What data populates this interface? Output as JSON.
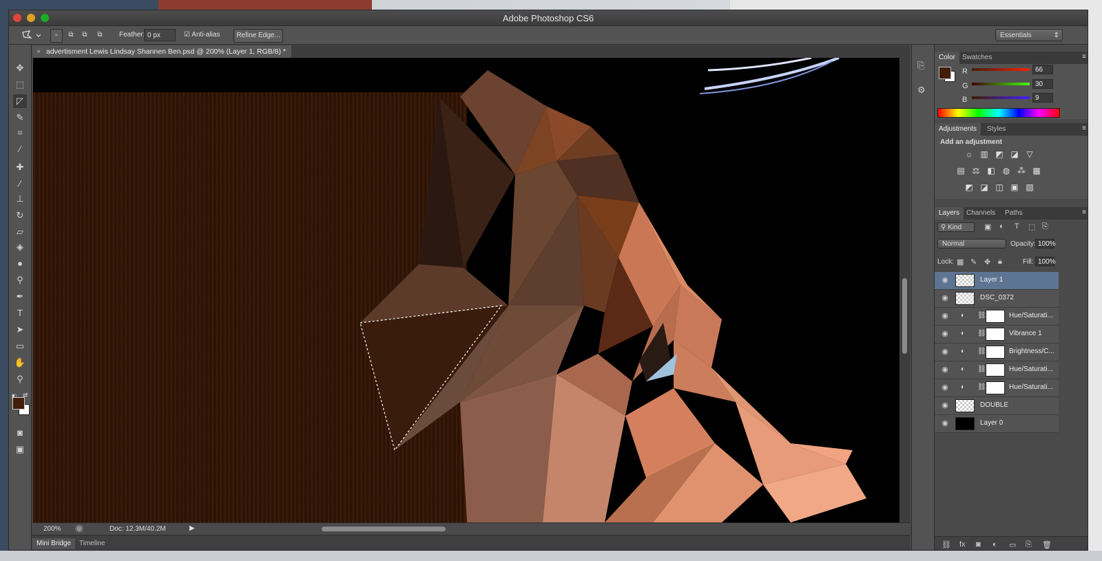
{
  "window": {
    "title": "Adobe Photoshop CS6"
  },
  "options_bar": {
    "feather_label": "Feather:",
    "feather_value": "0 px",
    "antialias_label": "Anti-alias",
    "refine_edge_label": "Refine Edge...",
    "workspace": "Essentials"
  },
  "document": {
    "tab_title": "advertisment Lewis Lindsay Shannen Ben.psd @ 200% (Layer 1, RGB/8) *",
    "close_glyph": "×"
  },
  "status": {
    "zoom": "200%",
    "doc_info": "Doc: 12.3M/40.2M"
  },
  "bottom_tabs": [
    "Mini Bridge",
    "Timeline"
  ],
  "color_panel": {
    "tabs": [
      "Color",
      "Swatches"
    ],
    "r_label": "R",
    "g_label": "G",
    "b_label": "B",
    "r": "66",
    "g": "30",
    "b": "9",
    "foreground": "#421e09"
  },
  "adjustments_panel": {
    "tabs": [
      "Adjustments",
      "Styles"
    ],
    "heading": "Add an adjustment"
  },
  "layers_panel": {
    "tabs": [
      "Layers",
      "Channels",
      "Paths"
    ],
    "filter_kind": "Kind",
    "blend_mode": "Normal",
    "opacity_label": "Opacity:",
    "opacity_value": "100%",
    "lock_label": "Lock:",
    "fill_label": "Fill:",
    "fill_value": "100%",
    "layers": [
      {
        "name": "Layer 1",
        "selected": true,
        "type": "pixel"
      },
      {
        "name": "DSC_0372",
        "selected": false,
        "type": "pixel"
      },
      {
        "name": "Hue/Saturati...",
        "selected": false,
        "type": "adjustment"
      },
      {
        "name": "Vibrance 1",
        "selected": false,
        "type": "adjustment"
      },
      {
        "name": "Brightness/C...",
        "selected": false,
        "type": "adjustment"
      },
      {
        "name": "Hue/Saturati...",
        "selected": false,
        "type": "adjustment"
      },
      {
        "name": "Hue/Saturati...",
        "selected": false,
        "type": "adjustment"
      },
      {
        "name": "DOUBLE",
        "selected": false,
        "type": "pixel"
      },
      {
        "name": "Layer 0",
        "selected": false,
        "type": "fill"
      }
    ]
  },
  "colors": {
    "selection_highlight": "#5d7492",
    "canvas_background": "#000000"
  }
}
